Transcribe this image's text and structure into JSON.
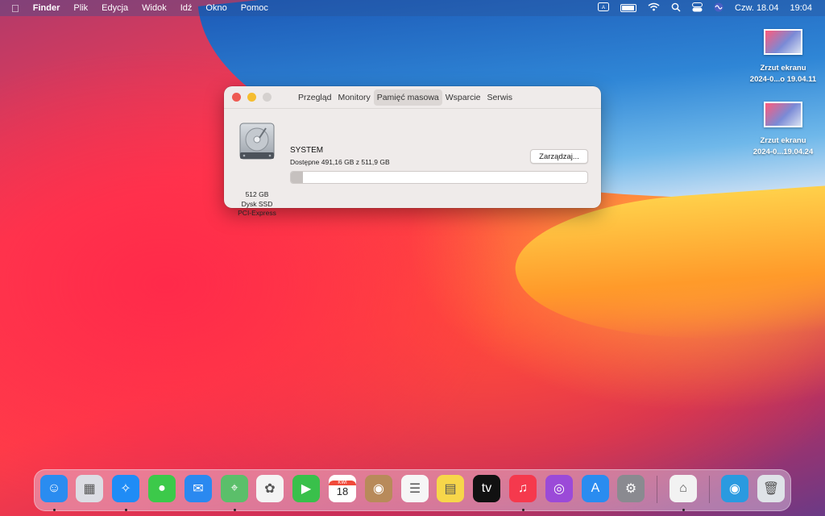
{
  "menubar": {
    "app_name": "Finder",
    "menus": [
      "Plik",
      "Edycja",
      "Widok",
      "Idź",
      "Okno",
      "Pomoc"
    ],
    "date": "Czw. 18.04",
    "time": "19:04"
  },
  "desktop": {
    "items": [
      {
        "line1": "Zrzut ekranu",
        "line2": "2024-0...o 19.04.11"
      },
      {
        "line1": "Zrzut ekranu",
        "line2": "2024-0...19.04.24"
      }
    ]
  },
  "window": {
    "tabs": [
      "Przegląd",
      "Monitory",
      "Pamięć masowa",
      "Wsparcie",
      "Serwis"
    ],
    "active_tab": "Pamięć masowa",
    "disk": {
      "size": "512 GB",
      "type": "Dysk SSD",
      "bus": "PCI-Express"
    },
    "volume": {
      "name": "SYSTEM",
      "available": "Dostępne 491,16 GB z 511,9 GB",
      "used_fraction": 0.04
    },
    "manage_button": "Zarządzaj..."
  },
  "dock": {
    "apps": [
      {
        "name": "finder-icon",
        "color": "#2a8cf0",
        "glyph": "☺",
        "running": true
      },
      {
        "name": "launchpad-icon",
        "color": "#dcdde4",
        "glyph": "▦",
        "running": false
      },
      {
        "name": "safari-icon",
        "color": "#1f8cf6",
        "glyph": "✧",
        "running": true
      },
      {
        "name": "messages-icon",
        "color": "#3cc94a",
        "glyph": "●",
        "running": false
      },
      {
        "name": "mail-icon",
        "color": "#2a89f0",
        "glyph": "✉",
        "running": false
      },
      {
        "name": "maps-icon",
        "color": "#5bbf6a",
        "glyph": "⌖",
        "running": true
      },
      {
        "name": "photos-icon",
        "color": "#f4f4f4",
        "glyph": "✿",
        "running": false
      },
      {
        "name": "facetime-icon",
        "color": "#39c04b",
        "glyph": "▶",
        "running": false
      },
      {
        "name": "calendar-icon",
        "color": "#ffffff",
        "glyph": "18",
        "label": "KWI",
        "running": false
      },
      {
        "name": "contacts-icon",
        "color": "#b88a5a",
        "glyph": "◉",
        "running": false
      },
      {
        "name": "reminders-icon",
        "color": "#f6f6f6",
        "glyph": "☰",
        "running": false
      },
      {
        "name": "notes-icon",
        "color": "#f7d64a",
        "glyph": "▤",
        "running": false
      },
      {
        "name": "apple-tv-icon",
        "color": "#111111",
        "glyph": "tv",
        "running": false
      },
      {
        "name": "music-icon",
        "color": "#f5394d",
        "glyph": "♫",
        "running": true
      },
      {
        "name": "podcasts-icon",
        "color": "#9b4ad8",
        "glyph": "◎",
        "running": false
      },
      {
        "name": "app-store-icon",
        "color": "#2a8cf0",
        "glyph": "A",
        "running": false
      },
      {
        "name": "system-preferences-icon",
        "color": "#8a8a90",
        "glyph": "⚙",
        "running": false
      },
      {
        "name": "system-information-icon",
        "color": "#f2f2f2",
        "glyph": "⌂",
        "running": true
      },
      {
        "name": "downloads-icon",
        "color": "#2a9ae0",
        "glyph": "◉",
        "running": false
      },
      {
        "name": "trash-icon",
        "color": "#dfe3e8",
        "glyph": "🗑",
        "running": false
      }
    ]
  }
}
